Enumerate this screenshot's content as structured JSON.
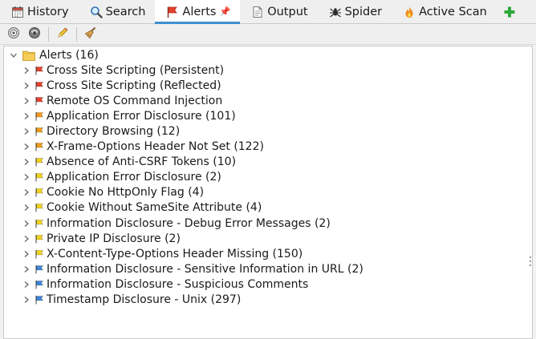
{
  "tabs": [
    {
      "label": "History",
      "icon": "history-icon",
      "selected": false
    },
    {
      "label": "Search",
      "icon": "search-icon",
      "selected": false
    },
    {
      "label": "Alerts",
      "icon": "alerts-flag-icon",
      "selected": true,
      "pinned": true
    },
    {
      "label": "Output",
      "icon": "output-icon",
      "selected": false
    },
    {
      "label": "Spider",
      "icon": "spider-icon",
      "selected": false
    },
    {
      "label": "Active Scan",
      "icon": "active-scan-icon",
      "selected": false
    }
  ],
  "add_tab_icon": "plus-icon",
  "toolbar": {
    "buttons": [
      "filter-target-icon",
      "scope-icon",
      "edit-alert-icon",
      "broom-clear-icon"
    ]
  },
  "tree": {
    "root_label": "Alerts (16)",
    "items": [
      {
        "label": "Cross Site Scripting (Persistent)",
        "risk": "high"
      },
      {
        "label": "Cross Site Scripting (Reflected)",
        "risk": "high"
      },
      {
        "label": "Remote OS Command Injection",
        "risk": "high"
      },
      {
        "label": "Application Error Disclosure (101)",
        "risk": "medium"
      },
      {
        "label": "Directory Browsing (12)",
        "risk": "medium"
      },
      {
        "label": "X-Frame-Options Header Not Set (122)",
        "risk": "medium"
      },
      {
        "label": "Absence of Anti-CSRF Tokens (10)",
        "risk": "low"
      },
      {
        "label": "Application Error Disclosure (2)",
        "risk": "low"
      },
      {
        "label": "Cookie No HttpOnly Flag (4)",
        "risk": "low"
      },
      {
        "label": "Cookie Without SameSite Attribute (4)",
        "risk": "low"
      },
      {
        "label": "Information Disclosure - Debug Error Messages (2)",
        "risk": "low"
      },
      {
        "label": "Private IP Disclosure (2)",
        "risk": "low"
      },
      {
        "label": "X-Content-Type-Options Header Missing (150)",
        "risk": "low"
      },
      {
        "label": "Information Disclosure - Sensitive Information in URL (2)",
        "risk": "info"
      },
      {
        "label": "Information Disclosure - Suspicious Comments",
        "risk": "info"
      },
      {
        "label": "Timestamp Disclosure - Unix (297)",
        "risk": "info"
      }
    ]
  },
  "risk_colors": {
    "high": "#e8402c",
    "medium": "#f39a1c",
    "low": "#f2d21b",
    "info": "#3f86d8"
  },
  "accent_color": "#3d8fd1"
}
